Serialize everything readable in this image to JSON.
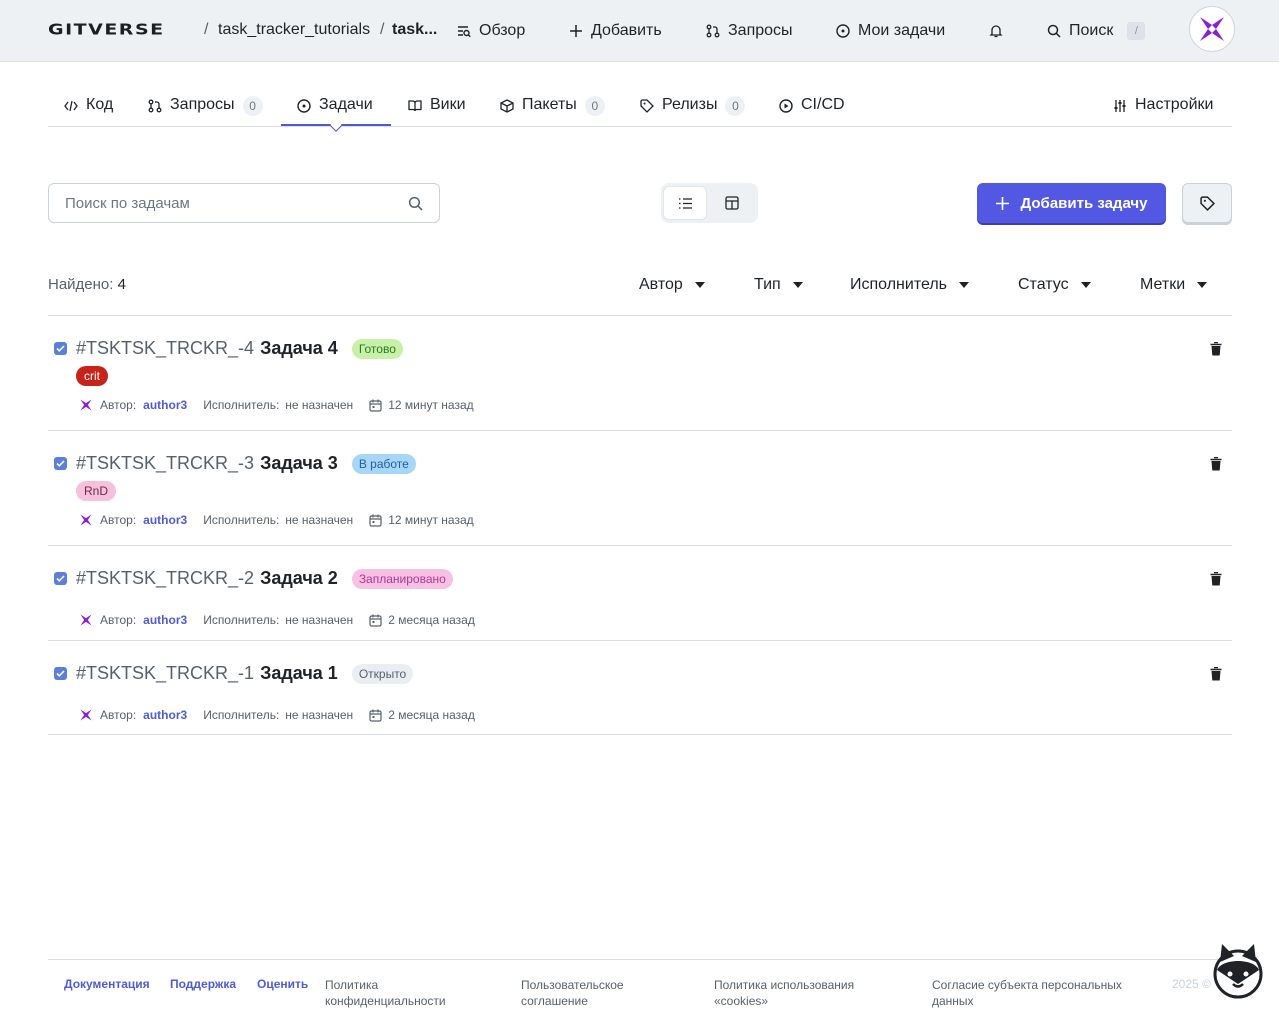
{
  "header": {
    "logo": "GITVERSE",
    "breadcrumb": {
      "sep": "/",
      "owner": "task_tracker_tutorials",
      "repo": "task..."
    },
    "nav": {
      "overview": "Обзор",
      "add": "Добавить",
      "requests": "Запросы",
      "my_tasks": "Мои задачи",
      "search": "Поиск",
      "search_hotkey": "/"
    }
  },
  "tabs": [
    {
      "label": "Код"
    },
    {
      "label": "Запросы",
      "count": "0"
    },
    {
      "label": "Задачи",
      "active": true
    },
    {
      "label": "Вики"
    },
    {
      "label": "Пакеты",
      "count": "0"
    },
    {
      "label": "Релизы",
      "count": "0"
    },
    {
      "label": "CI/CD"
    },
    {
      "label": "Настройки"
    }
  ],
  "toolbar": {
    "search_placeholder": "Поиск по задачам",
    "add_task": "Добавить задачу"
  },
  "filters": {
    "found_label": "Найдено:",
    "found_count": "4",
    "author": "Автор",
    "type": "Тип",
    "assignee": "Исполнитель",
    "status": "Статус",
    "labels": "Метки"
  },
  "issue_meta": {
    "author_label": "Автор:",
    "assignee_label": "Исполнитель:",
    "unassigned": "не назначен"
  },
  "issues": [
    {
      "num": "#TSKTSK_TRCKR_-4",
      "name": "Задача 4",
      "status": "Готово",
      "status_bg": "#c7f0a8",
      "status_fg": "#2d7a1f",
      "label": "crit",
      "label_bg": "#c8231b",
      "label_fg": "#ffffff",
      "author": "author3",
      "time": "12 минут назад"
    },
    {
      "num": "#TSKTSK_TRCKR_-3",
      "name": "Задача 3",
      "status": "В работе",
      "status_bg": "#a8d6f7",
      "status_fg": "#1f5fa6",
      "label": "RnD",
      "label_bg": "#f7c1dd",
      "label_fg": "#6b2a4b",
      "author": "author3",
      "time": "12 минут назад"
    },
    {
      "num": "#TSKTSK_TRCKR_-2",
      "name": "Задача 2",
      "status": "Запланировано",
      "status_bg": "#f7c1e6",
      "status_fg": "#b0378f",
      "label": "",
      "author": "author3",
      "time": "2 месяца назад"
    },
    {
      "num": "#TSKTSK_TRCKR_-1",
      "name": "Задача 1",
      "status": "Открыто",
      "status_bg": "#eaeef2",
      "status_fg": "#57606a",
      "label": "",
      "author": "author3",
      "time": "2 месяца назад"
    }
  ],
  "footer": {
    "docs": "Документация",
    "support": "Поддержка",
    "rate": "Оценить",
    "privacy_1": "Политика",
    "privacy_2": "конфиденциальности",
    "agreement_1": "Пользовательское",
    "agreement_2": "соглашение",
    "cookies_1": "Политика использования",
    "cookies_2": "«cookies»",
    "consent_1": "Согласие субъекта персональных",
    "consent_2": "данных",
    "copyright": "2025 ©"
  },
  "colors": {
    "accent": "#4f5bd5",
    "primary_button": "#5358e3",
    "brand_purple": "#8a1fd1"
  }
}
